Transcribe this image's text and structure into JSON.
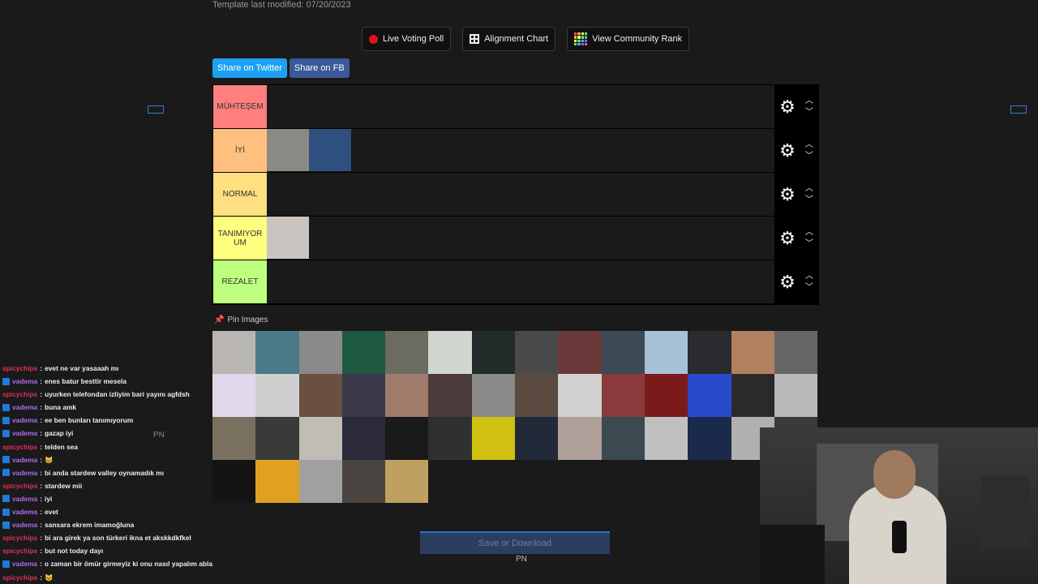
{
  "page": {
    "template_modified": "Template last modified: 07/20/2023"
  },
  "buttons": {
    "live_poll": "Live Voting Poll",
    "alignment_chart": "Alignment Chart",
    "community_rank": "View Community Rank",
    "share_twitter": "Share on Twitter",
    "share_fb": "Share on FB"
  },
  "tiers": [
    {
      "label": "MÜHTEŞEM",
      "color": "#ff7f7f",
      "items": []
    },
    {
      "label": "İYİ",
      "color": "#ffbf7f",
      "items": [
        "#8a8a85",
        "#2f4f7e"
      ]
    },
    {
      "label": "NORMAL",
      "color": "#ffdf7f",
      "items": []
    },
    {
      "label": "TANIMIYORUM",
      "color": "#ffff7f",
      "items": [
        "#c9c4c0"
      ]
    },
    {
      "label": "REZALET",
      "color": "#bfff7f",
      "items": []
    }
  ],
  "pin_images": "Pin Images",
  "pool_colors": [
    "#b9b6b2",
    "#4a7a8a",
    "#8a8a88",
    "#1e5a40",
    "#6b6b62",
    "#cfd6d0",
    "#222a2a",
    "#4a4a4a",
    "#6a3a3a",
    "#3b4a55",
    "#a8c0d8",
    "#2a2a30",
    "#b08060",
    "#666",
    "#e0d8ea",
    "#cfcfcf",
    "#6a5040",
    "#3a3a4a",
    "#a07a6a",
    "#4a3a3a",
    "#8a8a88",
    "#5a4a40",
    "#d0d0d0",
    "#8a3a3a",
    "#7a1a1a",
    "#2a4acc",
    "#2a2a2a",
    "#b9b9b9",
    "#7a7060",
    "#3a3a3a",
    "#c0bdb5",
    "#2a2a3a",
    "#1a1a1a",
    "#303030",
    "#d0c010",
    "#222a3a",
    "#b0a09a",
    "#3a4a50",
    "#c0c0c0",
    "#1a2a4a",
    "#b0b0b0",
    "#3a3a3a",
    "#141414",
    "#e0a020",
    "#a0a0a0",
    "#4a4440",
    "#c0a060"
  ],
  "save_button": "Save or Download",
  "pn": "PN",
  "chat": [
    {
      "user": "spicychips",
      "msg": "evet ne var yasaaah mı"
    },
    {
      "user": "vadema",
      "msg": "enes batur besttir mesela"
    },
    {
      "user": "spicychips",
      "msg": "uyurken telefondan izliyim bari yayını agfdsh"
    },
    {
      "user": "vadema",
      "msg": "buna amk"
    },
    {
      "user": "vadema",
      "msg": "ee ben bunları tanımıyorum"
    },
    {
      "user": "vadema",
      "msg": "gazap iyi"
    },
    {
      "user": "spicychips",
      "msg": "telden sea"
    },
    {
      "user": "vadema",
      "msg": "😸"
    },
    {
      "user": "vadema",
      "msg": "bi anda stardew valley oynamadık mı"
    },
    {
      "user": "spicychips",
      "msg": "stardew mii"
    },
    {
      "user": "vadema",
      "msg": "iyi"
    },
    {
      "user": "vadema",
      "msg": "evet"
    },
    {
      "user": "vadema",
      "msg": "sansara ekrem imamoğluna"
    },
    {
      "user": "spicychips",
      "msg": "bi ara girek ya son türkeri ikna et akskkdkfkel"
    },
    {
      "user": "spicychips",
      "msg": "but not today dayı"
    },
    {
      "user": "vadema",
      "msg": "o zaman bir ömür girmeyiz ki onu nasıl yapalım abla"
    },
    {
      "user": "spicychips",
      "msg": "😺"
    }
  ],
  "colors": {
    "spicychips": "#e0305a",
    "vadema": "#b06af0"
  }
}
